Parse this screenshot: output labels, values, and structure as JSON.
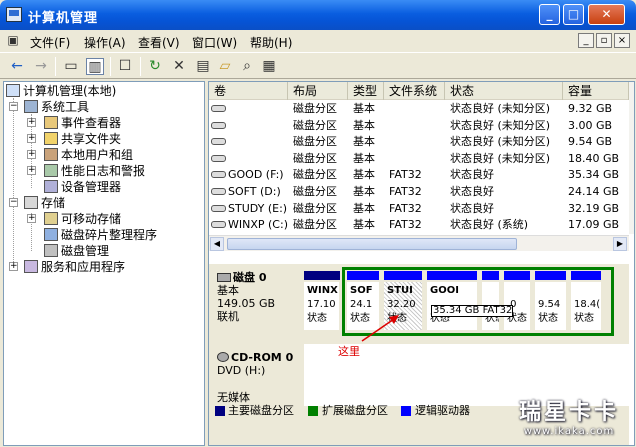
{
  "window": {
    "title": "计算机管理"
  },
  "menu": [
    "文件(F)",
    "操作(A)",
    "查看(V)",
    "窗口(W)",
    "帮助(H)"
  ],
  "tree": {
    "root": "计算机管理(本地)",
    "system_tools": "系统工具",
    "event_viewer": "事件查看器",
    "shared_folders": "共享文件夹",
    "local_users": "本地用户和组",
    "perf_logs": "性能日志和警报",
    "device_manager": "设备管理器",
    "storage": "存储",
    "removable_storage": "可移动存储",
    "defrag": "磁盘碎片整理程序",
    "disk_mgmt": "磁盘管理",
    "services": "服务和应用程序"
  },
  "columns": [
    "卷",
    "布局",
    "类型",
    "文件系统",
    "状态",
    "容量"
  ],
  "volumes": [
    {
      "name": "",
      "layout": "磁盘分区",
      "type": "基本",
      "fs": "",
      "status": "状态良好 (未知分区)",
      "capacity": "9.32 GB"
    },
    {
      "name": "",
      "layout": "磁盘分区",
      "type": "基本",
      "fs": "",
      "status": "状态良好 (未知分区)",
      "capacity": "3.00 GB"
    },
    {
      "name": "",
      "layout": "磁盘分区",
      "type": "基本",
      "fs": "",
      "status": "状态良好 (未知分区)",
      "capacity": "9.54 GB"
    },
    {
      "name": "",
      "layout": "磁盘分区",
      "type": "基本",
      "fs": "",
      "status": "状态良好 (未知分区)",
      "capacity": "18.40 GB"
    },
    {
      "name": "GOOD (F:)",
      "layout": "磁盘分区",
      "type": "基本",
      "fs": "FAT32",
      "status": "状态良好",
      "capacity": "35.34 GB"
    },
    {
      "name": "SOFT (D:)",
      "layout": "磁盘分区",
      "type": "基本",
      "fs": "FAT32",
      "status": "状态良好",
      "capacity": "24.14 GB"
    },
    {
      "name": "STUDY (E:)",
      "layout": "磁盘分区",
      "type": "基本",
      "fs": "FAT32",
      "status": "状态良好",
      "capacity": "32.19 GB"
    },
    {
      "name": "WINXP (C:)",
      "layout": "磁盘分区",
      "type": "基本",
      "fs": "FAT32",
      "status": "状态良好 (系统)",
      "capacity": "17.09 GB"
    }
  ],
  "disk0": {
    "name": "磁盘 0",
    "type": "基本",
    "size": "149.05 GB",
    "state": "联机",
    "partitions": [
      {
        "name": "WINX",
        "size": "17.10",
        "status": "状态"
      },
      {
        "name": "SOF",
        "size": "24.1",
        "status": "状态"
      },
      {
        "name": "STUI",
        "size": "32.20",
        "status": "状态"
      },
      {
        "name": "GOOI",
        "size": "",
        "status": "状态"
      },
      {
        "name": "",
        "size": "",
        "status": "状态"
      },
      {
        "name": "",
        "size": ".0",
        "status": "状态"
      },
      {
        "name": "",
        "size": "9.54",
        "status": "状态"
      },
      {
        "name": "",
        "size": "18.4(",
        "status": "状态"
      }
    ]
  },
  "cdrom0": {
    "name": "CD-ROM 0",
    "drive": "DVD (H:)",
    "media": "无媒体"
  },
  "callout": "35.34 GB FAT32",
  "annotation": "这里",
  "legend": [
    "主要磁盘分区",
    "扩展磁盘分区",
    "逻辑驱动器"
  ],
  "colors": {
    "primary": "#000080",
    "extended": "#008000",
    "logical": "#0000ff",
    "annotation": "#dd0000"
  },
  "watermark": {
    "brand": "瑞星卡卡",
    "url": "www.ikaka.com"
  }
}
